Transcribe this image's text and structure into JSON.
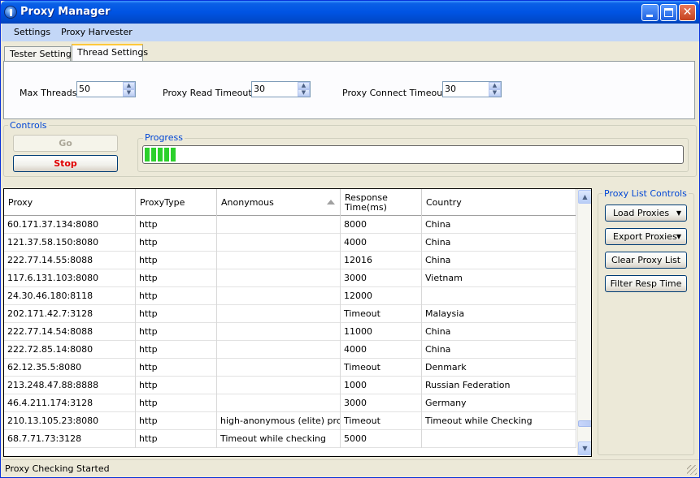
{
  "window": {
    "title": "Proxy Manager"
  },
  "menu": {
    "items": [
      "Settings",
      "Proxy Harvester"
    ]
  },
  "tabs": [
    {
      "label": "Tester Settings",
      "active": false
    },
    {
      "label": "Thread Settings",
      "active": true
    }
  ],
  "thread_settings": {
    "max_threads": {
      "label": "Max Threads:",
      "value": "50"
    },
    "read_timeout": {
      "label": "Proxy Read Timeout:",
      "value": "30"
    },
    "connect_timeout": {
      "label": "Proxy Connect Timeout:",
      "value": "30"
    }
  },
  "controls": {
    "group_label": "Controls",
    "go_label": "Go",
    "stop_label": "Stop"
  },
  "progress": {
    "label": "Progress",
    "fraction": 0.06
  },
  "table": {
    "columns": [
      "Proxy",
      "ProxyType",
      "Anonymous",
      "Response Time(ms)",
      "Country"
    ],
    "rows": [
      [
        "60.171.37.134:8080",
        "http",
        "",
        "8000",
        "China"
      ],
      [
        "121.37.58.150:8080",
        "http",
        "",
        "4000",
        "China"
      ],
      [
        "222.77.14.55:8088",
        "http",
        "",
        "12016",
        "China"
      ],
      [
        "117.6.131.103:8080",
        "http",
        "",
        "3000",
        "Vietnam"
      ],
      [
        "24.30.46.180:8118",
        "http",
        "",
        "12000",
        ""
      ],
      [
        "202.171.42.7:3128",
        "http",
        "",
        "Timeout",
        "Malaysia"
      ],
      [
        "222.77.14.54:8088",
        "http",
        "",
        "11000",
        "China"
      ],
      [
        "222.72.85.14:8080",
        "http",
        "",
        "4000",
        "China"
      ],
      [
        "62.12.35.5:8080",
        "http",
        "",
        "Timeout",
        "Denmark"
      ],
      [
        "213.248.47.88:8888",
        "http",
        "",
        "1000",
        "Russian Federation"
      ],
      [
        "46.4.211.174:3128",
        "http",
        "",
        "3000",
        "Germany"
      ],
      [
        "210.13.105.23:8080",
        "http",
        "high-anonymous (elite) proxy",
        "Timeout",
        "Timeout while Checking"
      ],
      [
        "68.7.71.73:3128",
        "http",
        "Timeout while checking",
        "5000",
        ""
      ]
    ]
  },
  "side": {
    "group_label": "Proxy List Controls",
    "load_label": "Load Proxies",
    "export_label": "Export Proxies",
    "clear_label": "Clear Proxy List",
    "filter_label": "Filter Resp Time"
  },
  "status": {
    "text": "Proxy Checking Started"
  }
}
